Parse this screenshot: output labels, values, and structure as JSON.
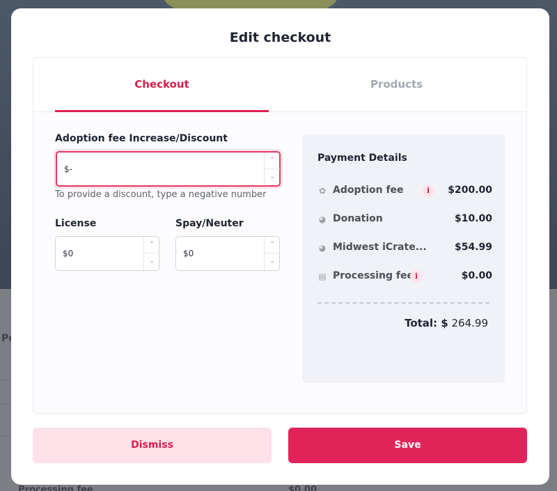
{
  "background": {
    "partial_text_left": "Po",
    "partial_text_bottom": "Processing fee",
    "partial_amount_bottom": "$0.00"
  },
  "modal": {
    "title": "Edit checkout",
    "tabs": [
      {
        "label": "Checkout",
        "active": true
      },
      {
        "label": "Products",
        "active": false
      }
    ],
    "adoption_fee": {
      "label": "Adoption fee Increase/Discount",
      "value": "$-",
      "hint": "To provide a discount, type a negative number"
    },
    "license": {
      "label": "License",
      "value": "$0"
    },
    "spay_neuter": {
      "label": "Spay/Neuter",
      "value": "$0"
    },
    "payment": {
      "title": "Payment Details",
      "rows": [
        {
          "icon": "paw-icon",
          "name": "Adoption fee",
          "amount": "$200.00",
          "info": true
        },
        {
          "icon": "tag-icon",
          "name": "Donation",
          "amount": "$10.00",
          "info": false
        },
        {
          "icon": "tag-icon",
          "name": "Midwest iCrate...",
          "amount": "$54.99",
          "info": false
        },
        {
          "icon": "receipt-icon",
          "name": "Processing fee",
          "amount": "$0.00",
          "info": true
        }
      ],
      "total_label": "Total: $",
      "total_value": "264.99"
    },
    "buttons": {
      "dismiss": "Dismiss",
      "save": "Save"
    },
    "colors": {
      "accent": "#e0245a",
      "accent_light": "#fde0e8",
      "panel": "#f1f2f8"
    }
  }
}
